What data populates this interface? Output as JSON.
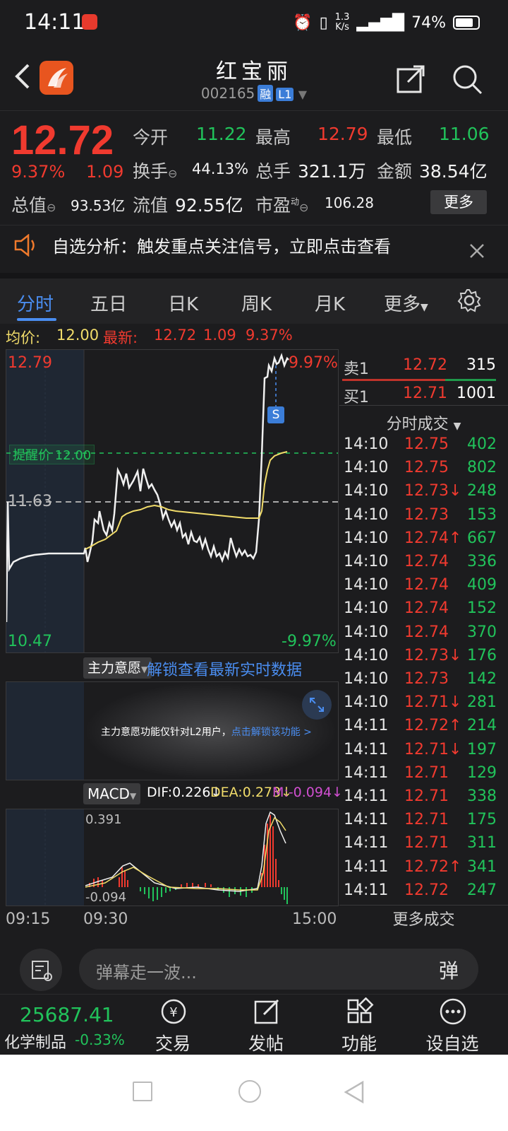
{
  "status": {
    "time": "14:11",
    "speed_value": "1.3",
    "speed_unit": "K/s",
    "battery": "74%"
  },
  "header": {
    "title": "红宝丽",
    "code": "002165",
    "tag_margin": "融",
    "tag_level": "L1"
  },
  "quote": {
    "price": "12.72",
    "pct": "9.37%",
    "change": "1.09",
    "open_label": "今开",
    "open": "11.22",
    "high_label": "最高",
    "high": "12.79",
    "low_label": "最低",
    "low": "11.06",
    "turnover_label": "换手",
    "turnover": "44.13%",
    "volume_label": "总手",
    "volume": "321.1万",
    "amount_label": "金额",
    "amount": "38.54亿",
    "mktcap_label": "总值",
    "mktcap": "93.53亿",
    "float_label": "流值",
    "float": "92.55亿",
    "pe_label": "市盈",
    "pe_sup": "动",
    "pe": "106.28",
    "more": "更多"
  },
  "alert": {
    "text": "自选分析：触发重点关注信号，立即点击查看"
  },
  "tabs": [
    "分时",
    "五日",
    "日K",
    "周K",
    "月K",
    "更多"
  ],
  "avg": {
    "avg_label": "均价:",
    "avg": "12.00",
    "last_label": "最新:",
    "last": "12.72",
    "chg": "1.09",
    "pct": "9.37%"
  },
  "intraday": {
    "y_high": "12.79",
    "y_low": "10.47",
    "pct_high": "9.97%",
    "pct_low": "-9.97%",
    "prev_close": "11.63",
    "reminder_label": "提醒价 12.00",
    "s_marker": "S"
  },
  "mainforce": {
    "dropdown": "主力意愿",
    "unlock": "解锁查看最新实时数据",
    "notice": "主力意愿功能仅针对L2用户，",
    "notice_link": "点击解锁该功能 >"
  },
  "macd": {
    "dropdown": "MACD",
    "dif": "DIF:0.226↓",
    "dea": "DEA:0.273↓",
    "m": "M:-0.094↓",
    "y_high": "0.391",
    "y_low": "-0.094"
  },
  "time_axis": {
    "t1": "09:15",
    "t2": "09:30",
    "t3": "15:00"
  },
  "book": {
    "sell_label": "卖1",
    "sell_price": "12.72",
    "sell_vol": "315",
    "buy_label": "买1",
    "buy_price": "12.71",
    "buy_vol": "1001",
    "ticks_title": "分时成交",
    "ticks": [
      {
        "t": "14:10",
        "p": "12.75",
        "v": "402"
      },
      {
        "t": "14:10",
        "p": "12.75",
        "v": "802"
      },
      {
        "t": "14:10",
        "p": "12.73↓",
        "v": "248"
      },
      {
        "t": "14:10",
        "p": "12.73",
        "v": "153"
      },
      {
        "t": "14:10",
        "p": "12.74↑",
        "v": "667"
      },
      {
        "t": "14:10",
        "p": "12.74",
        "v": "336"
      },
      {
        "t": "14:10",
        "p": "12.74",
        "v": "409"
      },
      {
        "t": "14:10",
        "p": "12.74",
        "v": "152"
      },
      {
        "t": "14:10",
        "p": "12.74",
        "v": "370"
      },
      {
        "t": "14:10",
        "p": "12.73↓",
        "v": "176"
      },
      {
        "t": "14:10",
        "p": "12.73",
        "v": "142"
      },
      {
        "t": "14:10",
        "p": "12.71↓",
        "v": "281"
      },
      {
        "t": "14:11",
        "p": "12.72↑",
        "v": "214"
      },
      {
        "t": "14:11",
        "p": "12.71↓",
        "v": "197"
      },
      {
        "t": "14:11",
        "p": "12.71",
        "v": "129"
      },
      {
        "t": "14:11",
        "p": "12.71",
        "v": "338"
      },
      {
        "t": "14:11",
        "p": "12.71",
        "v": "175"
      },
      {
        "t": "14:11",
        "p": "12.71",
        "v": "311"
      },
      {
        "t": "14:11",
        "p": "12.72↑",
        "v": "341"
      },
      {
        "t": "14:11",
        "p": "12.72",
        "v": "247"
      }
    ],
    "more_trades": "更多成交"
  },
  "comment": {
    "placeholder": "弹幕走一波...",
    "danmu": "弹"
  },
  "bottombar": {
    "index_value": "25687.41",
    "index_name": "化学制品",
    "index_pct": "-0.33%",
    "trade": "交易",
    "post": "发帖",
    "func": "功能",
    "watch": "设自选"
  },
  "colors": {
    "up": "#f03a2f",
    "down": "#21c35b",
    "accent": "#4a8df0",
    "avg_line": "#f1dc6a"
  }
}
